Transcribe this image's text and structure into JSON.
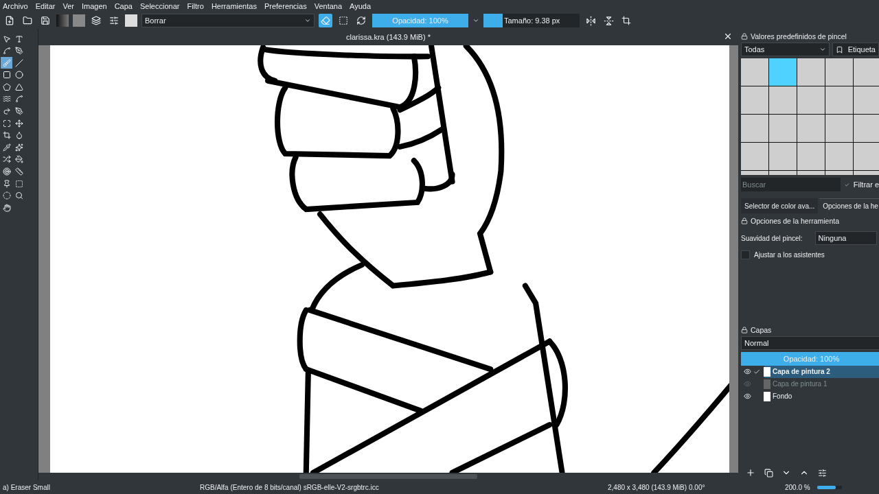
{
  "menu": [
    "Archivo",
    "Editar",
    "Ver",
    "Imagen",
    "Capa",
    "Seleccionar",
    "Filtro",
    "Herramientas",
    "Preferencias",
    "Ventana",
    "Ayuda"
  ],
  "toolbar": {
    "brush_name": "Borrar",
    "erase_mode_on": true,
    "opacity": {
      "label": "Opacidad: 100%",
      "level": 1
    },
    "size": {
      "label": "Tamaño: 9.38 px",
      "level": 0.2
    }
  },
  "tools": [
    {
      "selected": false
    },
    {
      "selected": false
    },
    {
      "selected": false
    },
    {
      "selected": false
    },
    {
      "selected": true
    },
    {
      "selected": false
    },
    {
      "selected": false
    },
    {
      "selected": false
    },
    {
      "selected": false
    },
    {
      "selected": false
    },
    {
      "selected": false
    },
    {
      "selected": false
    },
    {
      "selected": false
    },
    {
      "selected": false
    },
    {
      "selected": false
    },
    {
      "selected": false
    },
    {
      "selected": false
    },
    {
      "selected": false
    },
    {
      "selected": false
    },
    {
      "selected": false
    },
    {
      "selected": false
    },
    {
      "selected": false
    },
    {
      "selected": false
    },
    {
      "selected": false
    },
    {
      "selected": false
    },
    {
      "selected": false
    },
    {
      "selected": false
    },
    {
      "selected": false
    }
  ],
  "document": {
    "title": "clarissa.kra (143.9 MiB) *"
  },
  "brush_presets": {
    "title": "Valores predefinidos de pincel",
    "filter": "Todas",
    "tag_button": "Etiqueta",
    "search_placeholder": "Buscar",
    "filter_check": {
      "label": "Filtrar e",
      "checked": true
    },
    "items": [
      {
        "selected": false
      },
      {
        "selected": true
      },
      {
        "selected": false
      },
      {
        "selected": false
      },
      {
        "selected": false
      },
      {
        "selected": false
      },
      {
        "selected": false
      },
      {
        "selected": false
      },
      {
        "selected": false
      },
      {
        "selected": false
      },
      {
        "selected": false
      },
      {
        "selected": false
      },
      {
        "selected": false
      },
      {
        "selected": false
      },
      {
        "selected": false
      },
      {
        "selected": false
      },
      {
        "selected": false
      },
      {
        "selected": false
      },
      {
        "selected": false
      },
      {
        "selected": false
      },
      {
        "selected": false
      },
      {
        "selected": false
      },
      {
        "selected": false
      },
      {
        "selected": false
      },
      {
        "selected": false
      }
    ]
  },
  "dock_tabs": [
    {
      "label": "Selector de color ava...",
      "selected": false
    },
    {
      "label": "Opciones de la he",
      "selected": true
    }
  ],
  "tool_options": {
    "title": "Opciones de la herramienta",
    "smoothing_label": "Suavidad del pincel:",
    "smoothing_value": "Ninguna",
    "snap": {
      "label": "Ajustar a los asistentes",
      "checked": false
    }
  },
  "layers": {
    "title": "Capas",
    "blend_mode": "Normal",
    "opacity": {
      "label": "Opacidad:  100%",
      "level": 1
    },
    "items": [
      {
        "name": "Capa de pintura 2",
        "visible": true,
        "selected": true
      },
      {
        "name": "Capa de pintura 1",
        "visible": false,
        "selected": false
      },
      {
        "name": "Fondo",
        "visible": true,
        "selected": false
      }
    ]
  },
  "status_bar": {
    "brush": "a) Eraser Small",
    "color_space": "RGB/Alfa (Entero de 8 bits/canal)  sRGB-elle-V2-srgbtrc.icc",
    "dimensions": "2,480 x 3,480 (143.9 MiB)",
    "rotation": "0.00°",
    "zoom": "200.0 %",
    "zoom_slider": {
      "level": 0.75
    }
  }
}
